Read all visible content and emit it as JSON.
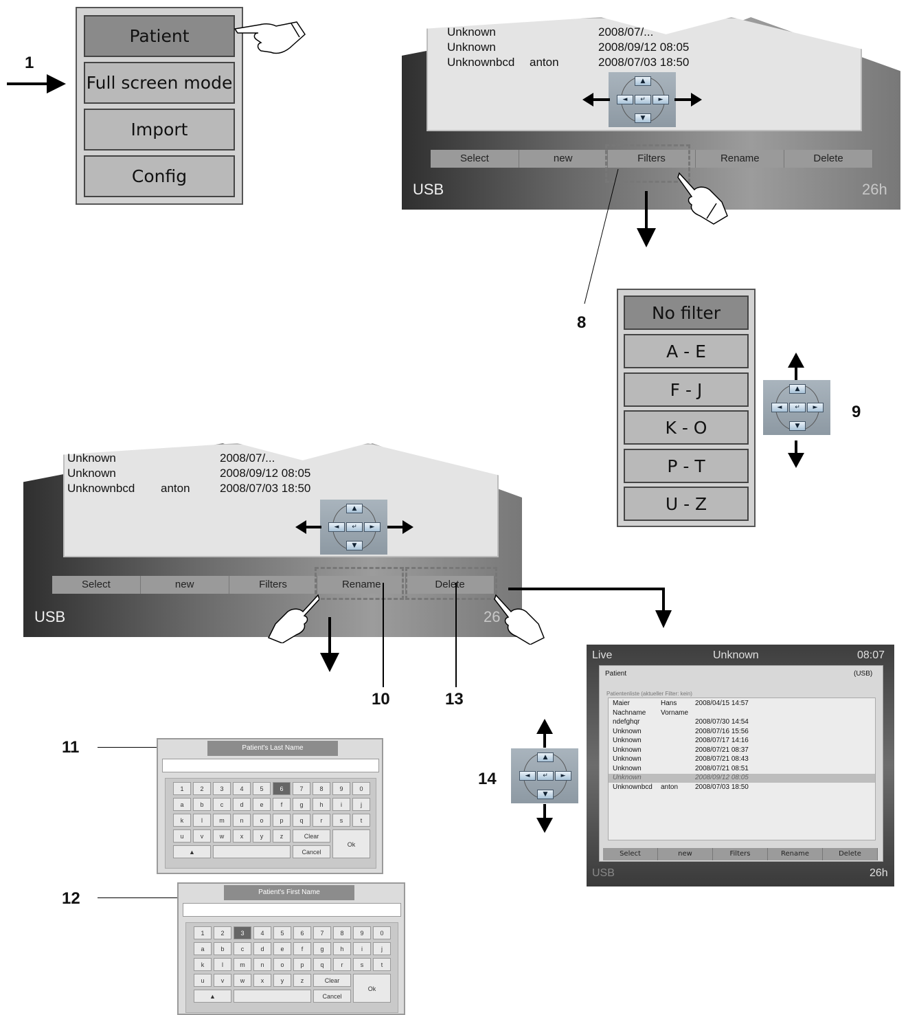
{
  "labels": {
    "n1": "1",
    "n8": "8",
    "n9": "9",
    "n10": "10",
    "n11": "11",
    "n12": "12",
    "n13": "13",
    "n14": "14"
  },
  "main_menu": {
    "items": [
      "Patient",
      "Full screen mode",
      "Import",
      "Config"
    ],
    "active": 0
  },
  "patient_list_preview": {
    "rows": [
      {
        "name": "Unknown",
        "first": "",
        "date": "2008/07/..."
      },
      {
        "name": "Unknown",
        "first": "",
        "date": "2008/09/12 08:05"
      },
      {
        "name": "Unknownbcd",
        "first": "anton",
        "date": "2008/07/03 18:50"
      }
    ],
    "softkeys": [
      "Select",
      "new",
      "Filters",
      "Rename",
      "Delete"
    ],
    "storage": "USB",
    "hours": "26h",
    "hours_partial": "26"
  },
  "filter_menu": {
    "items": [
      "No filter",
      "A - E",
      "F - J",
      "K - O",
      "P - T",
      "U - Z"
    ],
    "active": 0
  },
  "keyboard_last": {
    "title": "Patient's Last Name",
    "highlight": "6"
  },
  "keyboard_first": {
    "title": "Patient's First Name",
    "highlight": "3"
  },
  "keyboard_keys": {
    "row1": [
      "1",
      "2",
      "3",
      "4",
      "5",
      "6",
      "7",
      "8",
      "9",
      "0"
    ],
    "row2": [
      "a",
      "b",
      "c",
      "d",
      "e",
      "f",
      "g",
      "h",
      "i",
      "j"
    ],
    "row3": [
      "k",
      "l",
      "m",
      "n",
      "o",
      "p",
      "q",
      "r",
      "s",
      "t"
    ],
    "row4": [
      "u",
      "v",
      "w",
      "x",
      "y",
      "z"
    ],
    "clear": "Clear",
    "cancel": "Cancel",
    "ok": "Ok",
    "shift": "▲"
  },
  "navpad": {
    "up": "▲",
    "down": "▼",
    "left": "◄",
    "right": "►",
    "enter": "↵"
  },
  "full_screen": {
    "mode": "Live",
    "patient": "Unknown",
    "time": "08:07",
    "section": "Patient",
    "storage_tag": "(USB)",
    "caption": "Patientenliste (aktueller Filter: kein)",
    "rows": [
      {
        "name": "Maier",
        "first": "Hans",
        "date": "2008/04/15 14:57"
      },
      {
        "name": "Nachname",
        "first": "Vorname",
        "date": ""
      },
      {
        "name": "ndefghqr",
        "first": "",
        "date": "2008/07/30 14:54"
      },
      {
        "name": "Unknown",
        "first": "",
        "date": "2008/07/16 15:56"
      },
      {
        "name": "Unknown",
        "first": "",
        "date": "2008/07/17 14:16"
      },
      {
        "name": "Unknown",
        "first": "",
        "date": "2008/07/21 08:37"
      },
      {
        "name": "Unknown",
        "first": "",
        "date": "2008/07/21 08:43"
      },
      {
        "name": "Unknown",
        "first": "",
        "date": "2008/07/21 08:51"
      },
      {
        "name": "Unknown",
        "first": "",
        "date": "2008/09/12 08:05"
      },
      {
        "name": "Unknownbcd",
        "first": "anton",
        "date": "2008/07/03 18:50"
      }
    ],
    "selected_row": 8,
    "softkeys": [
      "Select",
      "new",
      "Filters",
      "Rename",
      "Delete"
    ],
    "storage": "USB",
    "hours": "26h"
  }
}
